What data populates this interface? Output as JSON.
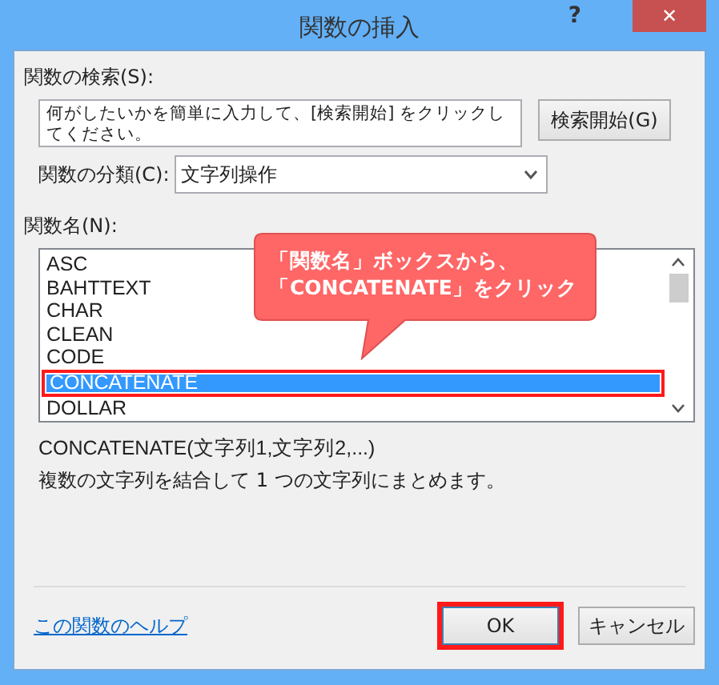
{
  "window": {
    "title": "関数の挿入",
    "help": "?",
    "close": "✕"
  },
  "search": {
    "label": "関数の検索(S):",
    "value": "何がしたいかを簡単に入力して、[検索開始] をクリックしてください。",
    "button": "検索開始(G)"
  },
  "category": {
    "label": "関数の分類(C):",
    "value": "文字列操作"
  },
  "functions": {
    "label": "関数名(N):",
    "items": [
      {
        "label": "ASC",
        "selected": false,
        "highlighted": false
      },
      {
        "label": "BAHTTEXT",
        "selected": false,
        "highlighted": false
      },
      {
        "label": "CHAR",
        "selected": false,
        "highlighted": false
      },
      {
        "label": "CLEAN",
        "selected": false,
        "highlighted": false
      },
      {
        "label": "CODE",
        "selected": false,
        "highlighted": false
      },
      {
        "label": "CONCATENATE",
        "selected": true,
        "highlighted": true
      },
      {
        "label": "DOLLAR",
        "selected": false,
        "highlighted": false
      }
    ]
  },
  "syntax": "CONCATENATE(文字列1,文字列2,...)",
  "description": "複数の文字列を結合して 1 つの文字列にまとめます。",
  "callout": {
    "lines": [
      "「関数名」ボックスから、",
      "「CONCATENATE」をクリック"
    ]
  },
  "help_link": "この関数のヘルプ",
  "buttons": [
    {
      "label": "OK",
      "highlighted": true
    },
    {
      "label": "キャンセル",
      "highlighted": false
    }
  ]
}
